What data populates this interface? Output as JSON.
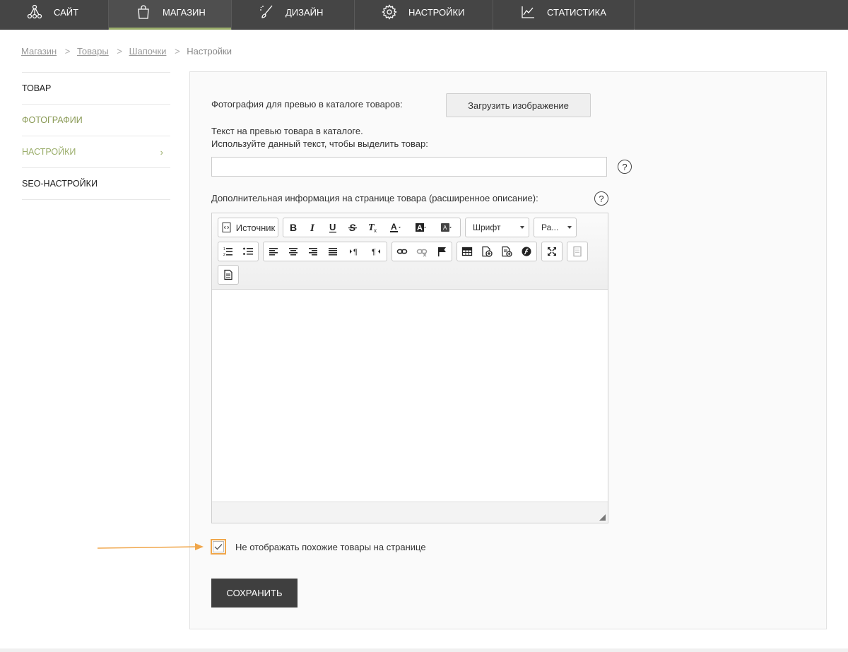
{
  "topnav": {
    "tabs": [
      {
        "label": "САЙТ",
        "icon": "nodes-icon"
      },
      {
        "label": "МАГАЗИН",
        "icon": "bag-icon",
        "active": true
      },
      {
        "label": "ДИЗАЙН",
        "icon": "brush-icon"
      },
      {
        "label": "НАСТРОЙКИ",
        "icon": "gear-icon"
      },
      {
        "label": "СТАТИСТИКА",
        "icon": "chart-icon"
      }
    ]
  },
  "breadcrumb": {
    "items": [
      "Магазин",
      "Товары",
      "Шапочки"
    ],
    "current": "Настройки",
    "separator": ">"
  },
  "sidebar": {
    "items": [
      {
        "label": "ТОВАР"
      },
      {
        "label": "ФОТОГРАФИИ"
      },
      {
        "label": "НАСТРОЙКИ",
        "active": true
      },
      {
        "label": "SEO-НАСТРОЙКИ"
      }
    ],
    "chevron": "›"
  },
  "form": {
    "preview_photo_label": "Фотография для превью в каталоге товаров:",
    "upload_button": "Загрузить изображение",
    "preview_text_label_line1": "Текст на превью товара в каталоге.",
    "preview_text_label_line2": "Используйте данный текст, чтобы выделить товар:",
    "preview_text_value": "",
    "help_glyph": "?",
    "extended_desc_label": "Дополнительная информация на странице товара (расширенное описание):",
    "hide_similar_label": "Не отображать похожие товары на странице",
    "hide_similar_checked": true,
    "save_button": "СОХРАНИТЬ"
  },
  "editor": {
    "source_label": "Источник",
    "font_combo": "Шрифт",
    "size_combo": "Ра...",
    "content": ""
  },
  "colors": {
    "nav_bg": "#454545",
    "accent_green": "#9aad6a",
    "highlight_orange": "#f0a64a",
    "save_bg": "#3f3f3f"
  }
}
